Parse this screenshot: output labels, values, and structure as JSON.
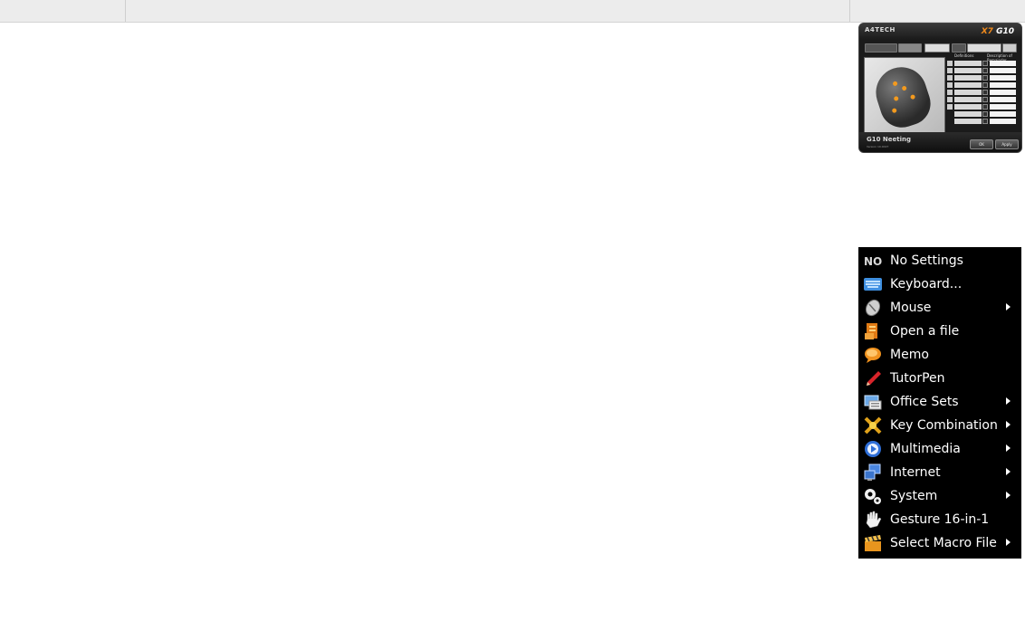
{
  "app_window": {
    "brand": "A4TECH",
    "logo_prefix": "X7",
    "logo_suffix": "G10",
    "product": "G10 Neeting",
    "version": "Version 10.0027",
    "definition_header": "Definitions",
    "description_header": "Description of Remainder",
    "ok_label": "OK",
    "apply_label": "Apply"
  },
  "menu": {
    "items": [
      {
        "label": "No Settings",
        "icon": "no-settings-icon",
        "submenu": false
      },
      {
        "label": "Keyboard...",
        "icon": "keyboard-icon",
        "submenu": false
      },
      {
        "label": "Mouse",
        "icon": "mouse-icon",
        "submenu": true
      },
      {
        "label": "Open a file",
        "icon": "open-file-icon",
        "submenu": false
      },
      {
        "label": "Memo",
        "icon": "memo-icon",
        "submenu": false
      },
      {
        "label": "TutorPen",
        "icon": "pen-icon",
        "submenu": false
      },
      {
        "label": "Office Sets",
        "icon": "office-icon",
        "submenu": true
      },
      {
        "label": "Key Combination",
        "icon": "key-combination-icon",
        "submenu": true
      },
      {
        "label": "Multimedia",
        "icon": "multimedia-icon",
        "submenu": true
      },
      {
        "label": "Internet",
        "icon": "internet-icon",
        "submenu": true
      },
      {
        "label": "System",
        "icon": "gears-icon",
        "submenu": true
      },
      {
        "label": "Gesture 16-in-1",
        "icon": "hand-icon",
        "submenu": false
      },
      {
        "label": "Select Macro File",
        "icon": "clapper-icon",
        "submenu": true
      }
    ]
  },
  "colors": {
    "menu_background": "#000000",
    "menu_text": "#ffffff",
    "accent": "#f08a1c"
  }
}
